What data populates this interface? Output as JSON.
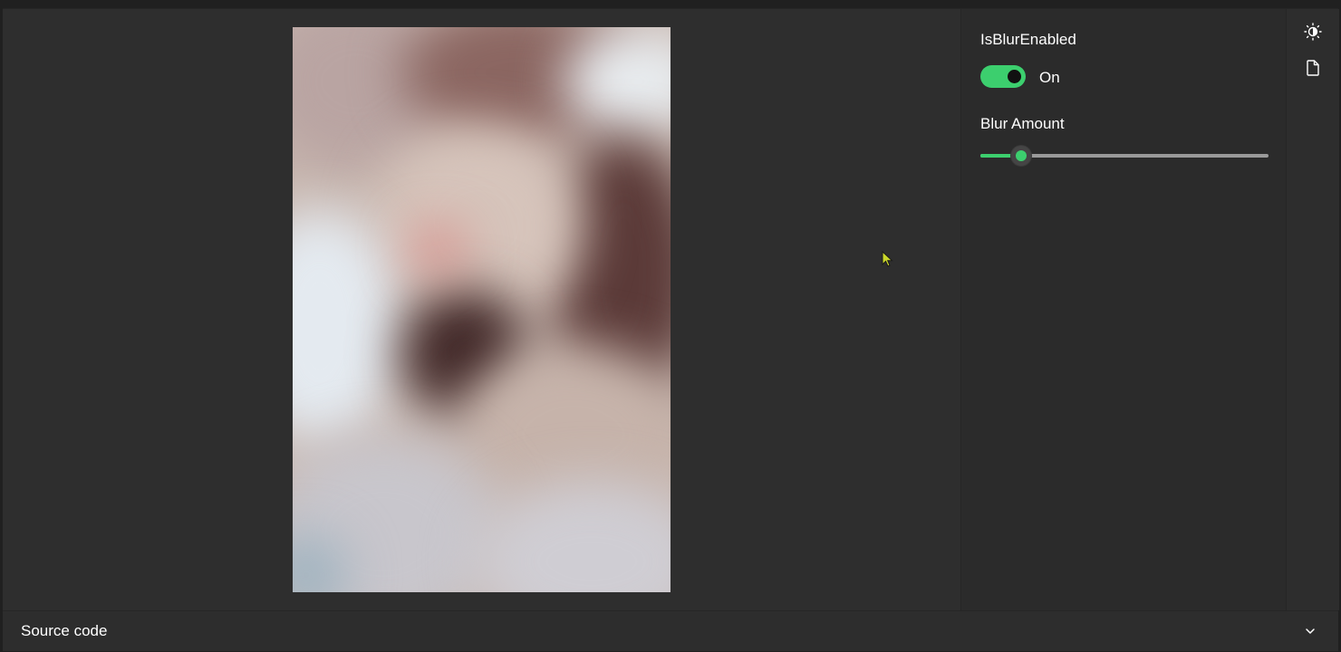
{
  "options": {
    "blur_toggle_label": "IsBlurEnabled",
    "blur_toggle_state": "On",
    "blur_enabled": true,
    "blur_amount_label": "Blur Amount",
    "blur_amount_fraction": 0.14
  },
  "footer": {
    "label": "Source code"
  },
  "toolbar": {
    "items": [
      {
        "icon": "theme-toggle-icon"
      },
      {
        "icon": "document-icon"
      }
    ]
  },
  "colors": {
    "accent": "#3ccf6e",
    "background": "#2e2e2e"
  }
}
